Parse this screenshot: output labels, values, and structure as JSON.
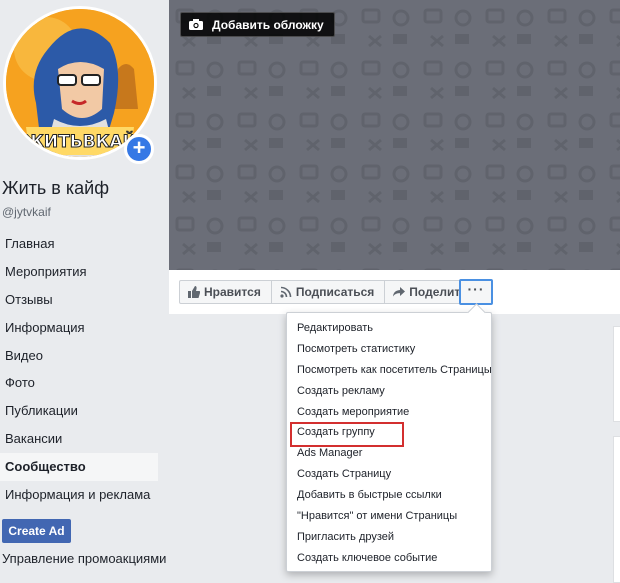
{
  "page": {
    "name": "Жить в кайф",
    "handle": "@jytvkaif",
    "avatar_text": "ЖИТЬВКАЙ"
  },
  "sidebar": {
    "items": [
      {
        "label": "Главная"
      },
      {
        "label": "Мероприятия"
      },
      {
        "label": "Отзывы"
      },
      {
        "label": "Информация"
      },
      {
        "label": "Видео"
      },
      {
        "label": "Фото"
      },
      {
        "label": "Публикации"
      },
      {
        "label": "Вакансии"
      },
      {
        "label": "Сообщество",
        "active": true
      },
      {
        "label": "Информация и реклама"
      }
    ],
    "create_ad_label": "Create Ad",
    "promo_label": "Управление промоакциями"
  },
  "cover": {
    "add_cover_label": "Добавить обложку"
  },
  "actions": {
    "like_label": "Нравится",
    "follow_label": "Подписаться",
    "share_label": "Поделиться",
    "more_label": "···"
  },
  "menu": {
    "items": [
      "Редактировать",
      "Посмотреть статистику",
      "Посмотреть как посетитель Страницы",
      "Создать рекламу",
      "Создать мероприятие",
      "Создать группу",
      "Ads Manager",
      "Создать Страницу",
      "Добавить в быстрые ссылки",
      "\"Нравится\" от имени Страницы",
      "Пригласить друзей",
      "Создать ключевое событие"
    ],
    "highlighted": "Создать группу"
  },
  "colors": {
    "brand": "#4267b2",
    "plus_badge": "#3578e5",
    "cover": "#6b6e78",
    "highlight_box": "#d32f2f",
    "focus_border": "#4a90e2"
  }
}
